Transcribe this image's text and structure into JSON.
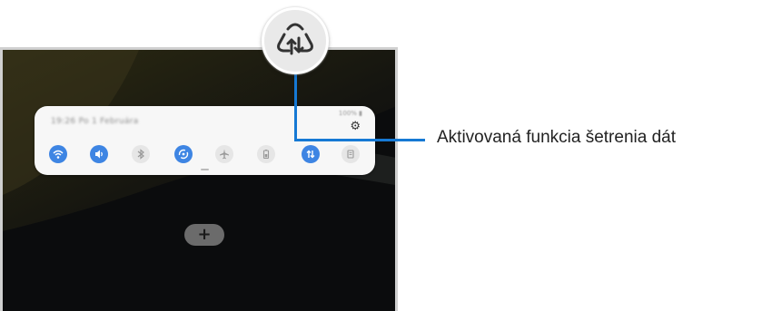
{
  "quick_panel": {
    "date": "19:26 Po 1 Februára",
    "status": "100% ▮",
    "icons": {
      "settings": "gear-icon",
      "wifi": "wifi-icon",
      "sound": "sound-icon",
      "bluetooth": "bluetooth-icon",
      "auto_rotate": "auto-rotate-icon",
      "airplane": "airplane-icon",
      "battery": "power-saving-icon",
      "data_saver": "data-saver-icon",
      "more": "more-icon"
    },
    "colors": {
      "active": "#3e85e3",
      "inactive": "#e6e6e6"
    }
  },
  "zoom": {
    "icon": "data-saver-icon"
  },
  "callout": {
    "label": "Aktivovaná funkcia šetrenia dát",
    "line_color": "#1679d4"
  },
  "home": {
    "add_icon": "add-icon"
  }
}
